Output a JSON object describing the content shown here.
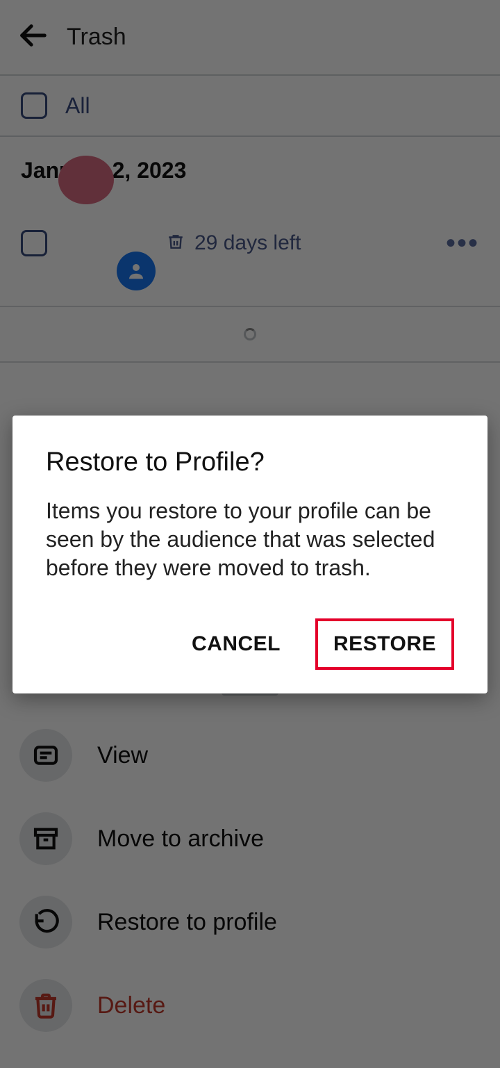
{
  "header": {
    "title": "Trash"
  },
  "filter": {
    "all_label": "All"
  },
  "group": {
    "date": "January 2, 2023",
    "item": {
      "days_left": "29 days left"
    }
  },
  "sheet": {
    "view": "View",
    "archive": "Move to archive",
    "restore": "Restore to profile",
    "delete": "Delete"
  },
  "dialog": {
    "title": "Restore to Profile?",
    "body": "Items you restore to your profile can be seen by the audience that was selected before they were moved to trash.",
    "cancel": "CANCEL",
    "confirm": "RESTORE"
  }
}
